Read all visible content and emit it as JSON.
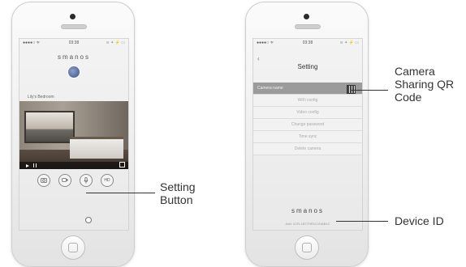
{
  "left_phone": {
    "status": {
      "carrier": "●●●●○ ᯤ",
      "time": "03:38",
      "right": "≋ ✦ ⚡ ▭"
    },
    "brand": "smanos",
    "camera_name": "Lily's Bedroom",
    "controls": [
      "",
      "",
      "",
      "HD"
    ],
    "annotation": {
      "line1": "Setting",
      "line2": "Button"
    }
  },
  "right_phone": {
    "status": {
      "carrier": "●●●●○ ᯤ",
      "time": "03:38",
      "right": "≋ ✦ ⚡ ▭"
    },
    "back": "‹",
    "title": "Setting",
    "menu": [
      "Camera name",
      "WiFi config",
      "Video config",
      "Change password",
      "Time sync",
      "Delete camera"
    ],
    "brand": "smanos",
    "device_id": "Add: 1CFL1B77HR1C1HAB1C",
    "annotation_qr": {
      "line1": "Camera",
      "line2": "Sharing QR",
      "line3": "Code"
    },
    "annotation_id": "Device ID"
  }
}
